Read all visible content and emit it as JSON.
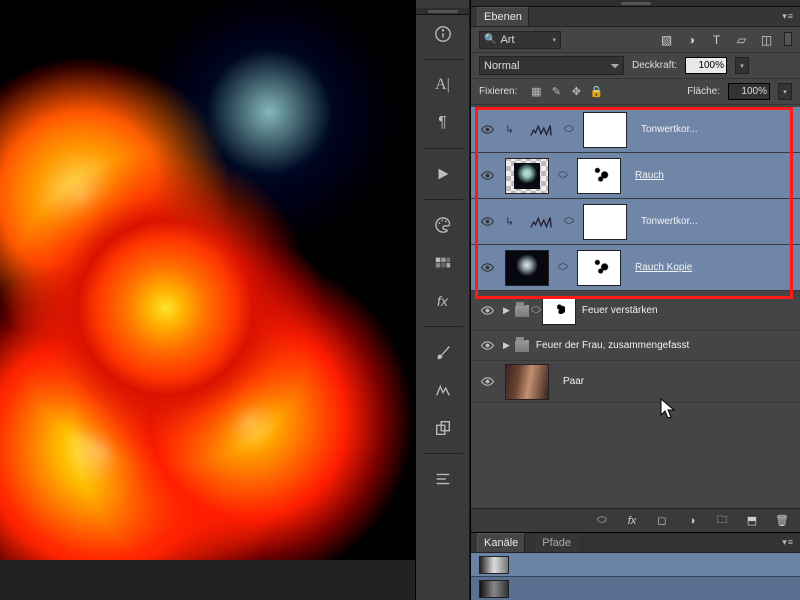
{
  "panel_title": "Ebenen",
  "filter_label": "Art",
  "blend_mode": "Normal",
  "opacity_label": "Deckkraft:",
  "opacity_value": "100%",
  "fill_label": "Fläche:",
  "fill_value": "100%",
  "lock_label": "Fixieren:",
  "layers": [
    {
      "name": "Tonwertkor...",
      "kind": "adjustment",
      "clipped": true
    },
    {
      "name": "Rauch",
      "kind": "image",
      "clipped": false
    },
    {
      "name": "Tonwertkor...",
      "kind": "adjustment",
      "clipped": true
    },
    {
      "name": "Rauch Kopie",
      "kind": "image",
      "clipped": false
    }
  ],
  "group1_name": "Feuer verstärken",
  "group2_name": "Feuer der Frau, zusammengefasst",
  "base_layer_name": "Paar",
  "channels_title": "Kanäle",
  "paths_title": "Pfade"
}
